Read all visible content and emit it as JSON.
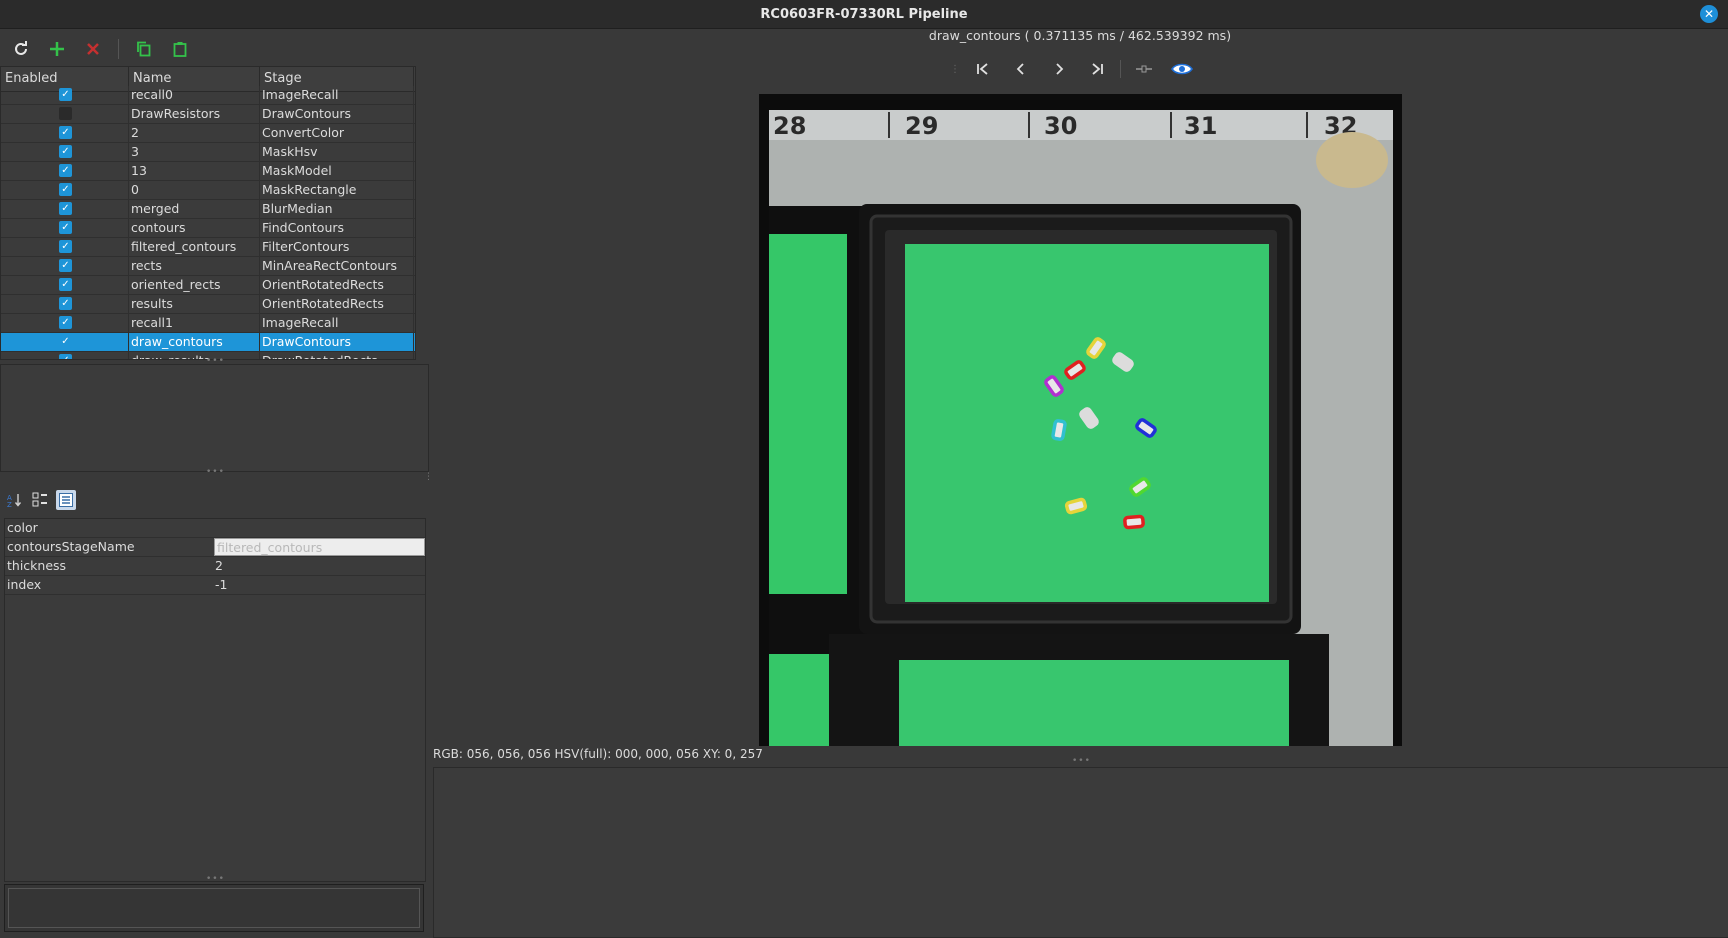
{
  "window": {
    "title": "RC0603FR-07330RL Pipeline"
  },
  "toolbar": {
    "refresh": "refresh-icon",
    "add": "plus-icon",
    "remove": "close-icon",
    "copy": "copy-icon",
    "paste": "paste-icon"
  },
  "table": {
    "headers": [
      "Enabled",
      "Name",
      "Stage"
    ],
    "rows": [
      {
        "enabled": true,
        "name": "recall0",
        "stage": "ImageRecall"
      },
      {
        "enabled": false,
        "name": "DrawResistors",
        "stage": "DrawContours"
      },
      {
        "enabled": true,
        "name": "2",
        "stage": "ConvertColor"
      },
      {
        "enabled": true,
        "name": "3",
        "stage": "MaskHsv"
      },
      {
        "enabled": true,
        "name": "13",
        "stage": "MaskModel"
      },
      {
        "enabled": true,
        "name": "0",
        "stage": "MaskRectangle"
      },
      {
        "enabled": true,
        "name": "merged",
        "stage": "BlurMedian"
      },
      {
        "enabled": true,
        "name": "contours",
        "stage": "FindContours"
      },
      {
        "enabled": true,
        "name": "filtered_contours",
        "stage": "FilterContours"
      },
      {
        "enabled": true,
        "name": "rects",
        "stage": "MinAreaRectContours"
      },
      {
        "enabled": true,
        "name": "oriented_rects",
        "stage": "OrientRotatedRects"
      },
      {
        "enabled": true,
        "name": "results",
        "stage": "OrientRotatedRects"
      },
      {
        "enabled": true,
        "name": "recall1",
        "stage": "ImageRecall"
      },
      {
        "enabled": true,
        "name": "draw_contours",
        "stage": "DrawContours",
        "selected": true
      },
      {
        "enabled": true,
        "name": "draw_results",
        "stage": "DrawRotatedRects"
      }
    ]
  },
  "properties": {
    "rows": [
      {
        "key": "color",
        "value": ""
      },
      {
        "key": "contoursStageName",
        "value": "filtered_contours",
        "editing": true
      },
      {
        "key": "thickness",
        "value": "2"
      },
      {
        "key": "index",
        "value": "-1"
      }
    ]
  },
  "viewer": {
    "timing": "draw_contours ( 0.371135 ms / 462.539392 ms)",
    "ruler_numbers": [
      "28",
      "29",
      "30",
      "31",
      "32"
    ],
    "status": "RGB: 056, 056, 056 HSV(full): 000, 000, 056 XY: 0, 257"
  },
  "colors": {
    "accent": "#1e95d8",
    "green": "#2fcf73",
    "red": "#d93030"
  }
}
